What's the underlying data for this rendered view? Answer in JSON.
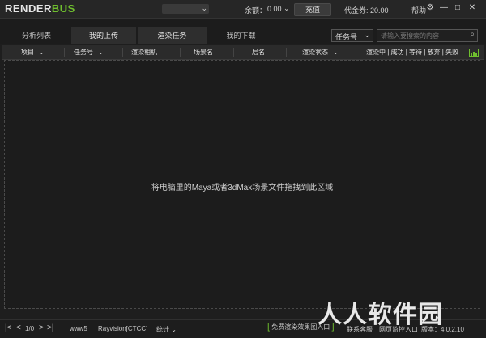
{
  "app": {
    "logo_main": "RENDER",
    "logo_accent": "BUS",
    "balance_label": "余额：",
    "balance_value": "0.00",
    "recharge_label": "充值",
    "voucher_text": "代金券: 20.00",
    "help_label": "帮助"
  },
  "tabs": [
    "分析列表",
    "我的上传",
    "渲染任务",
    "我的下载"
  ],
  "filter": {
    "task_select": "任务号"
  },
  "search": {
    "placeholder": "请输入要搜索的内容"
  },
  "table": {
    "columns": [
      "项目",
      "任务号",
      "渲染相机",
      "场景名",
      "层名",
      "渲染状态"
    ],
    "status_filter": "渲染中 | 成功 | 等待 | 放弃 | 失败"
  },
  "dropzone": {
    "message": "将电脑里的Maya或者3dMax场景文件拖拽到此区域"
  },
  "footer": {
    "page": "1/0",
    "user": "www5",
    "server": "Rayvision[CTCC]",
    "stats_label": "统计",
    "free_entry": "免费渲染效果图入口",
    "support": "联系客服",
    "web_monitor": "网页监控入口",
    "version": "版本：4.0.2.10"
  },
  "watermark": "人人软件园",
  "colors": {
    "accent": "#6fbf2e",
    "background": "#1e1e1e"
  }
}
